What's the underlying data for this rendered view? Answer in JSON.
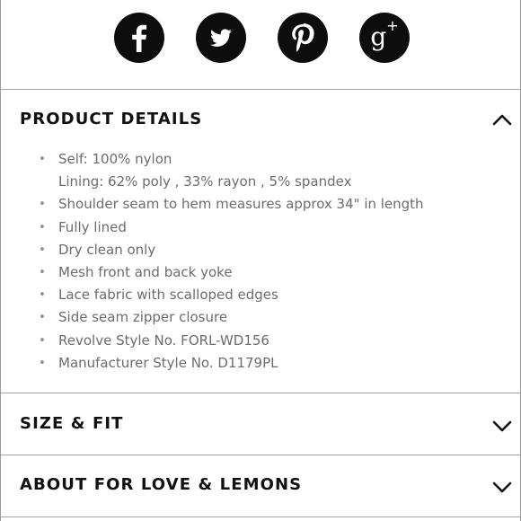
{
  "share": {
    "buttons": [
      {
        "icon": "facebook-icon",
        "glyph": "f"
      },
      {
        "icon": "twitter-icon",
        "glyph": ""
      },
      {
        "icon": "pinterest-icon",
        "glyph": "P"
      },
      {
        "icon": "google-plus-icon",
        "glyph": "g",
        "sup": "+"
      }
    ]
  },
  "sections": {
    "product_details": {
      "title": "PRODUCT DETAILS",
      "state": "expanded",
      "items": [
        {
          "text": "Self: 100% nylon",
          "bullet": true
        },
        {
          "text": "Lining: 62% poly , 33% rayon , 5% spandex",
          "bullet": false
        },
        {
          "text": "Shoulder seam to hem measures approx 34\" in length",
          "bullet": true
        },
        {
          "text": "Fully lined",
          "bullet": true
        },
        {
          "text": "Dry clean only",
          "bullet": true
        },
        {
          "text": "Mesh front and back yoke",
          "bullet": true
        },
        {
          "text": "Lace fabric with scalloped edges",
          "bullet": true
        },
        {
          "text": "Side seam zipper closure",
          "bullet": true
        },
        {
          "text": "Revolve Style No. FORL-WD156",
          "bullet": true
        },
        {
          "text": "Manufacturer Style No. D1179PL",
          "bullet": true
        }
      ]
    },
    "size_fit": {
      "title": "SIZE & FIT",
      "state": "collapsed"
    },
    "about": {
      "title": "ABOUT FOR LOVE & LEMONS",
      "state": "collapsed"
    }
  },
  "bullet_glyph": "•",
  "colors": {
    "icon_bg": "#0d0d0d",
    "divider": "#a3a3a3",
    "body_text": "#6c6c6c",
    "heading": "#111111"
  }
}
